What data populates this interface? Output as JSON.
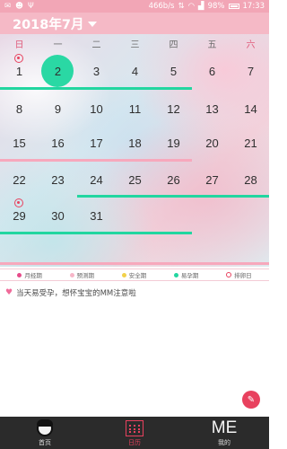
{
  "status_bar": {
    "network_speed": "466b/s",
    "battery": "98%",
    "time": "17:33"
  },
  "header": {
    "month_title": "2018年7月"
  },
  "calendar": {
    "weekdays": [
      "日",
      "一",
      "二",
      "三",
      "四",
      "五",
      "六"
    ],
    "weeks": [
      [
        "1",
        "2",
        "3",
        "4",
        "5",
        "6",
        "7"
      ],
      [
        "8",
        "9",
        "10",
        "11",
        "12",
        "13",
        "14"
      ],
      [
        "15",
        "16",
        "17",
        "18",
        "19",
        "20",
        "21"
      ],
      [
        "22",
        "23",
        "24",
        "25",
        "26",
        "27",
        "28"
      ],
      [
        "29",
        "30",
        "31",
        "",
        "",
        "",
        ""
      ]
    ],
    "today": "2",
    "ovulation_days": [
      "1",
      "29"
    ]
  },
  "legend": [
    {
      "label": "月经期",
      "color": "#e64b8a",
      "shape": "dot"
    },
    {
      "label": "预测期",
      "color": "#f7b6c8",
      "shape": "dot"
    },
    {
      "label": "安全期",
      "color": "#f2d14a",
      "shape": "dot"
    },
    {
      "label": "易孕期",
      "color": "#22d6a0",
      "shape": "dot"
    },
    {
      "label": "排卵日",
      "color": "#e8415e",
      "shape": "ring"
    }
  ],
  "tip": {
    "icon": "heart-icon",
    "text": "当天易受孕，想怀宝宝的MM注意啦"
  },
  "tabbar": {
    "tabs": [
      {
        "label": "首页",
        "icon": "face-icon"
      },
      {
        "label": "日历",
        "icon": "calendar-icon"
      },
      {
        "label": "我的",
        "icon": "me-icon",
        "icon_text": "ME"
      }
    ],
    "active": 1
  },
  "colors": {
    "accent": "#e8415e",
    "header": "#f5b9c6",
    "fertile": "#22d6a0"
  }
}
